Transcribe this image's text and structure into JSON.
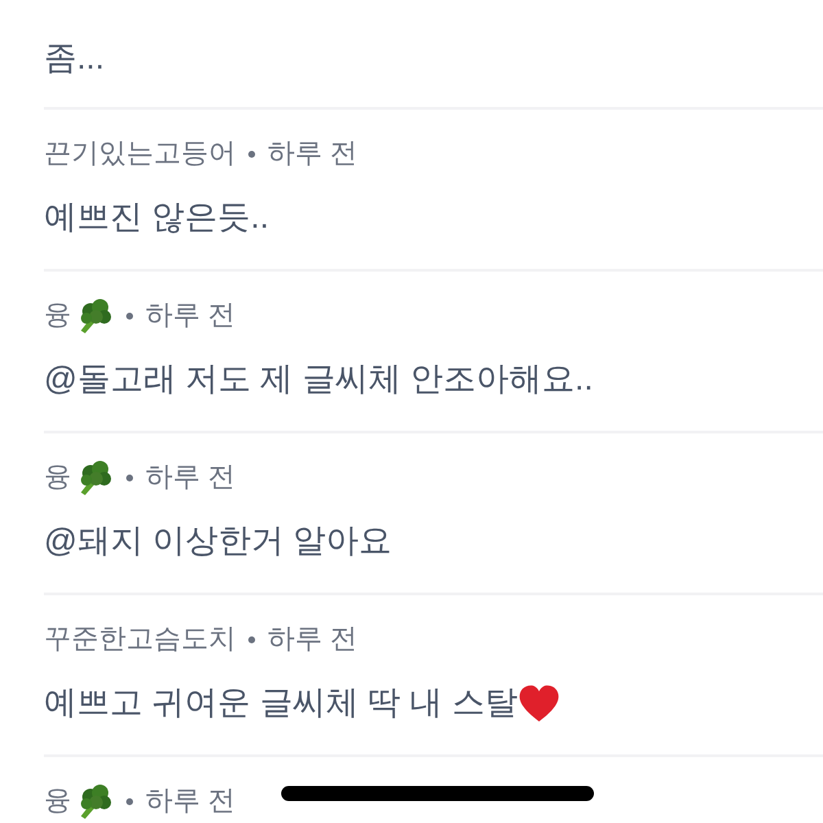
{
  "comments": [
    {
      "body": "좀..."
    },
    {
      "author": "끈기있는고등어",
      "time": "하루 전",
      "body": "예쁘진 않은듯.."
    },
    {
      "author": "융",
      "broccoli_icon": true,
      "time": "하루 전",
      "body": "@돌고래 저도 제 글씨체 안조아해요.."
    },
    {
      "author": "융",
      "broccoli_icon": true,
      "time": "하루 전",
      "body": "@돼지 이상한거 알아요"
    },
    {
      "author": "꾸준한고슴도치",
      "time": "하루 전",
      "body": "예쁘고 귀여운 글씨체 딱 내 스탈",
      "heart_icon": true
    },
    {
      "author": "융",
      "broccoli_icon": true,
      "time": "하루 전"
    }
  ]
}
